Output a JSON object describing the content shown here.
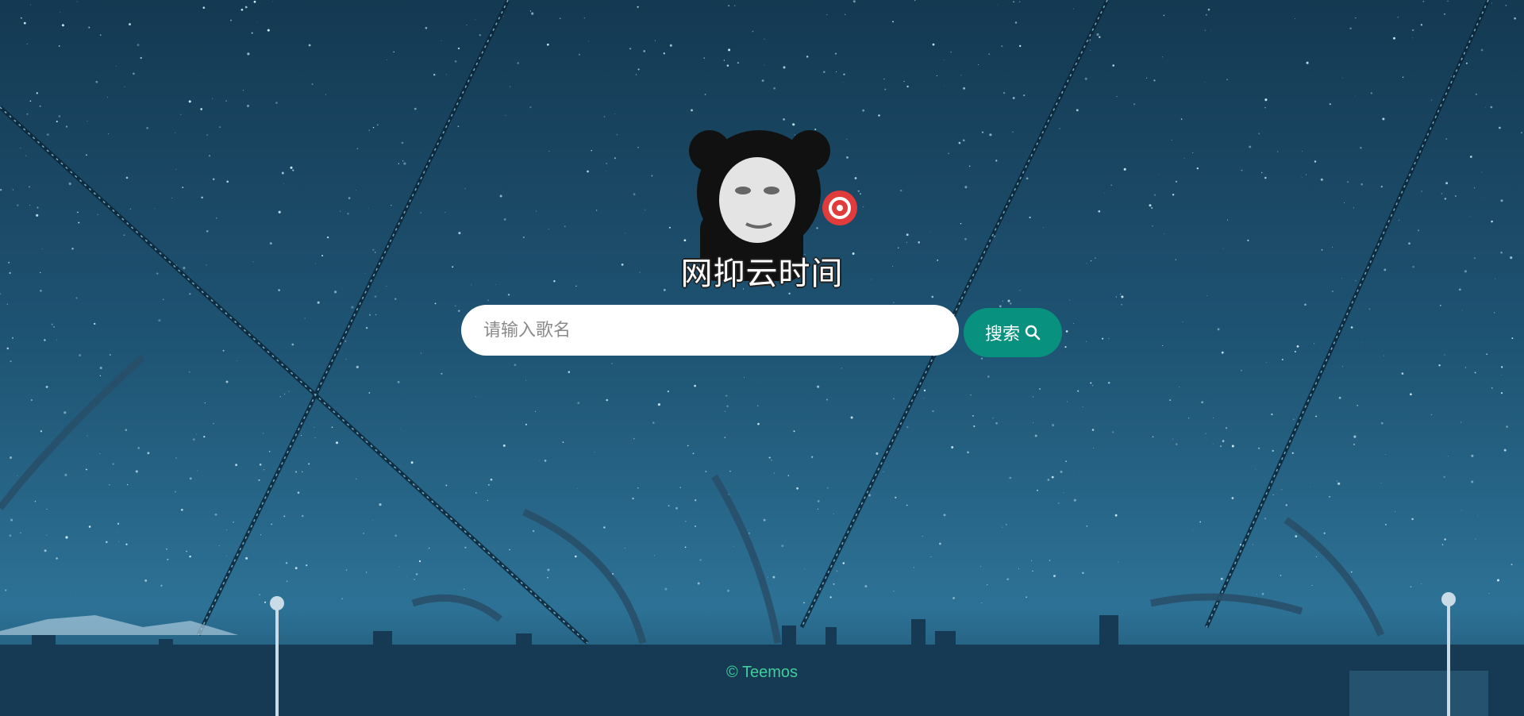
{
  "logo": {
    "icon": "panda-meme-icon",
    "text": "网抑云时间"
  },
  "search": {
    "placeholder": "请输入歌名",
    "value": "",
    "button_label": "搜索",
    "button_icon": "search-icon"
  },
  "footer": {
    "text": "© Teemos"
  },
  "colors": {
    "accent": "#08917f",
    "footer_text": "#3ecf9a",
    "sky": "#1d4c6a"
  }
}
